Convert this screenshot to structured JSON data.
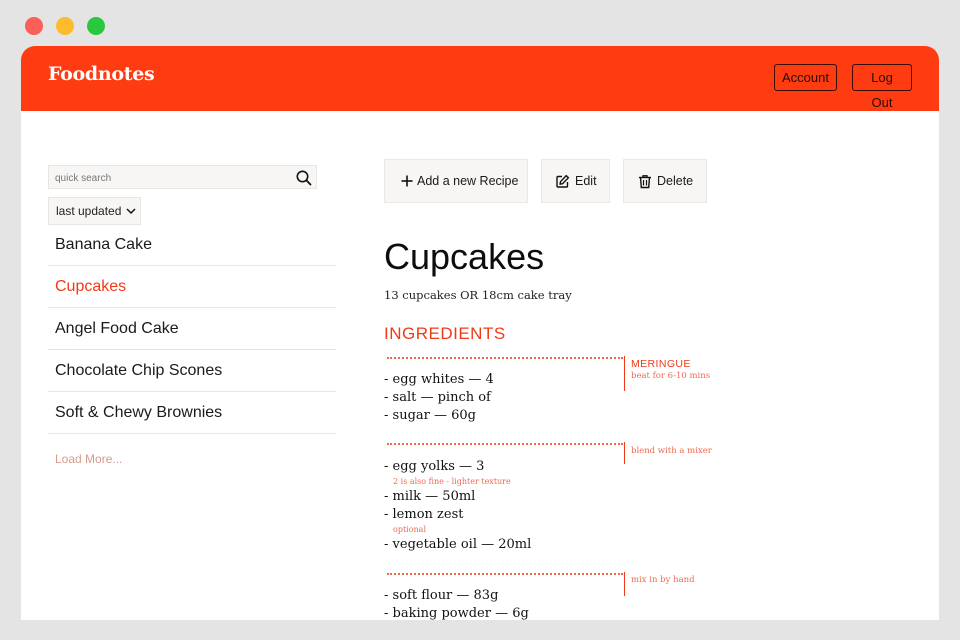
{
  "window": {
    "controls": [
      "close",
      "minimize",
      "maximize"
    ]
  },
  "header": {
    "brand": "Foodnotes",
    "account_label": "Account",
    "logout_label": "Log Out",
    "color": "#ff3b12"
  },
  "sidebar": {
    "search_placeholder": "quick search",
    "search_icon": "search-icon",
    "sort_label": "last updated",
    "recipes": [
      "Banana Cake",
      "Cupcakes",
      "Angel Food Cake",
      "Chocolate Chip Scones",
      "Soft & Chewy Brownies"
    ],
    "active_recipe": "Cupcakes",
    "load_more": "Load More..."
  },
  "toolbar": {
    "add_label": "Add a new Recipe",
    "edit_label": "Edit",
    "delete_label": "Delete"
  },
  "recipe": {
    "title": "Cupcakes",
    "yield": "13 cupcakes OR 18cm cake tray",
    "section_title": "INGREDIENTS",
    "groups": [
      {
        "heading": "MERINGUE",
        "note": "beat for 6-10 mins",
        "items": [
          "- egg whites  —  4",
          "- salt  —  pinch of",
          "- sugar  —  60g"
        ]
      },
      {
        "heading": "",
        "note": "blend with a mixer",
        "items": [
          "- egg yolks  —  3",
          "- milk  —  50ml",
          "- lemon zest",
          "- vegetable oil  —  20ml"
        ],
        "item_notes": [
          "2 is also fine - lighter texture",
          "optional"
        ]
      },
      {
        "heading": "",
        "note": "mix in by hand",
        "items": [
          "- soft flour  —  83g",
          "- baking powder  —  6g"
        ]
      }
    ]
  },
  "colors": {
    "accent": "#f03a17",
    "note": "#f06a52"
  }
}
